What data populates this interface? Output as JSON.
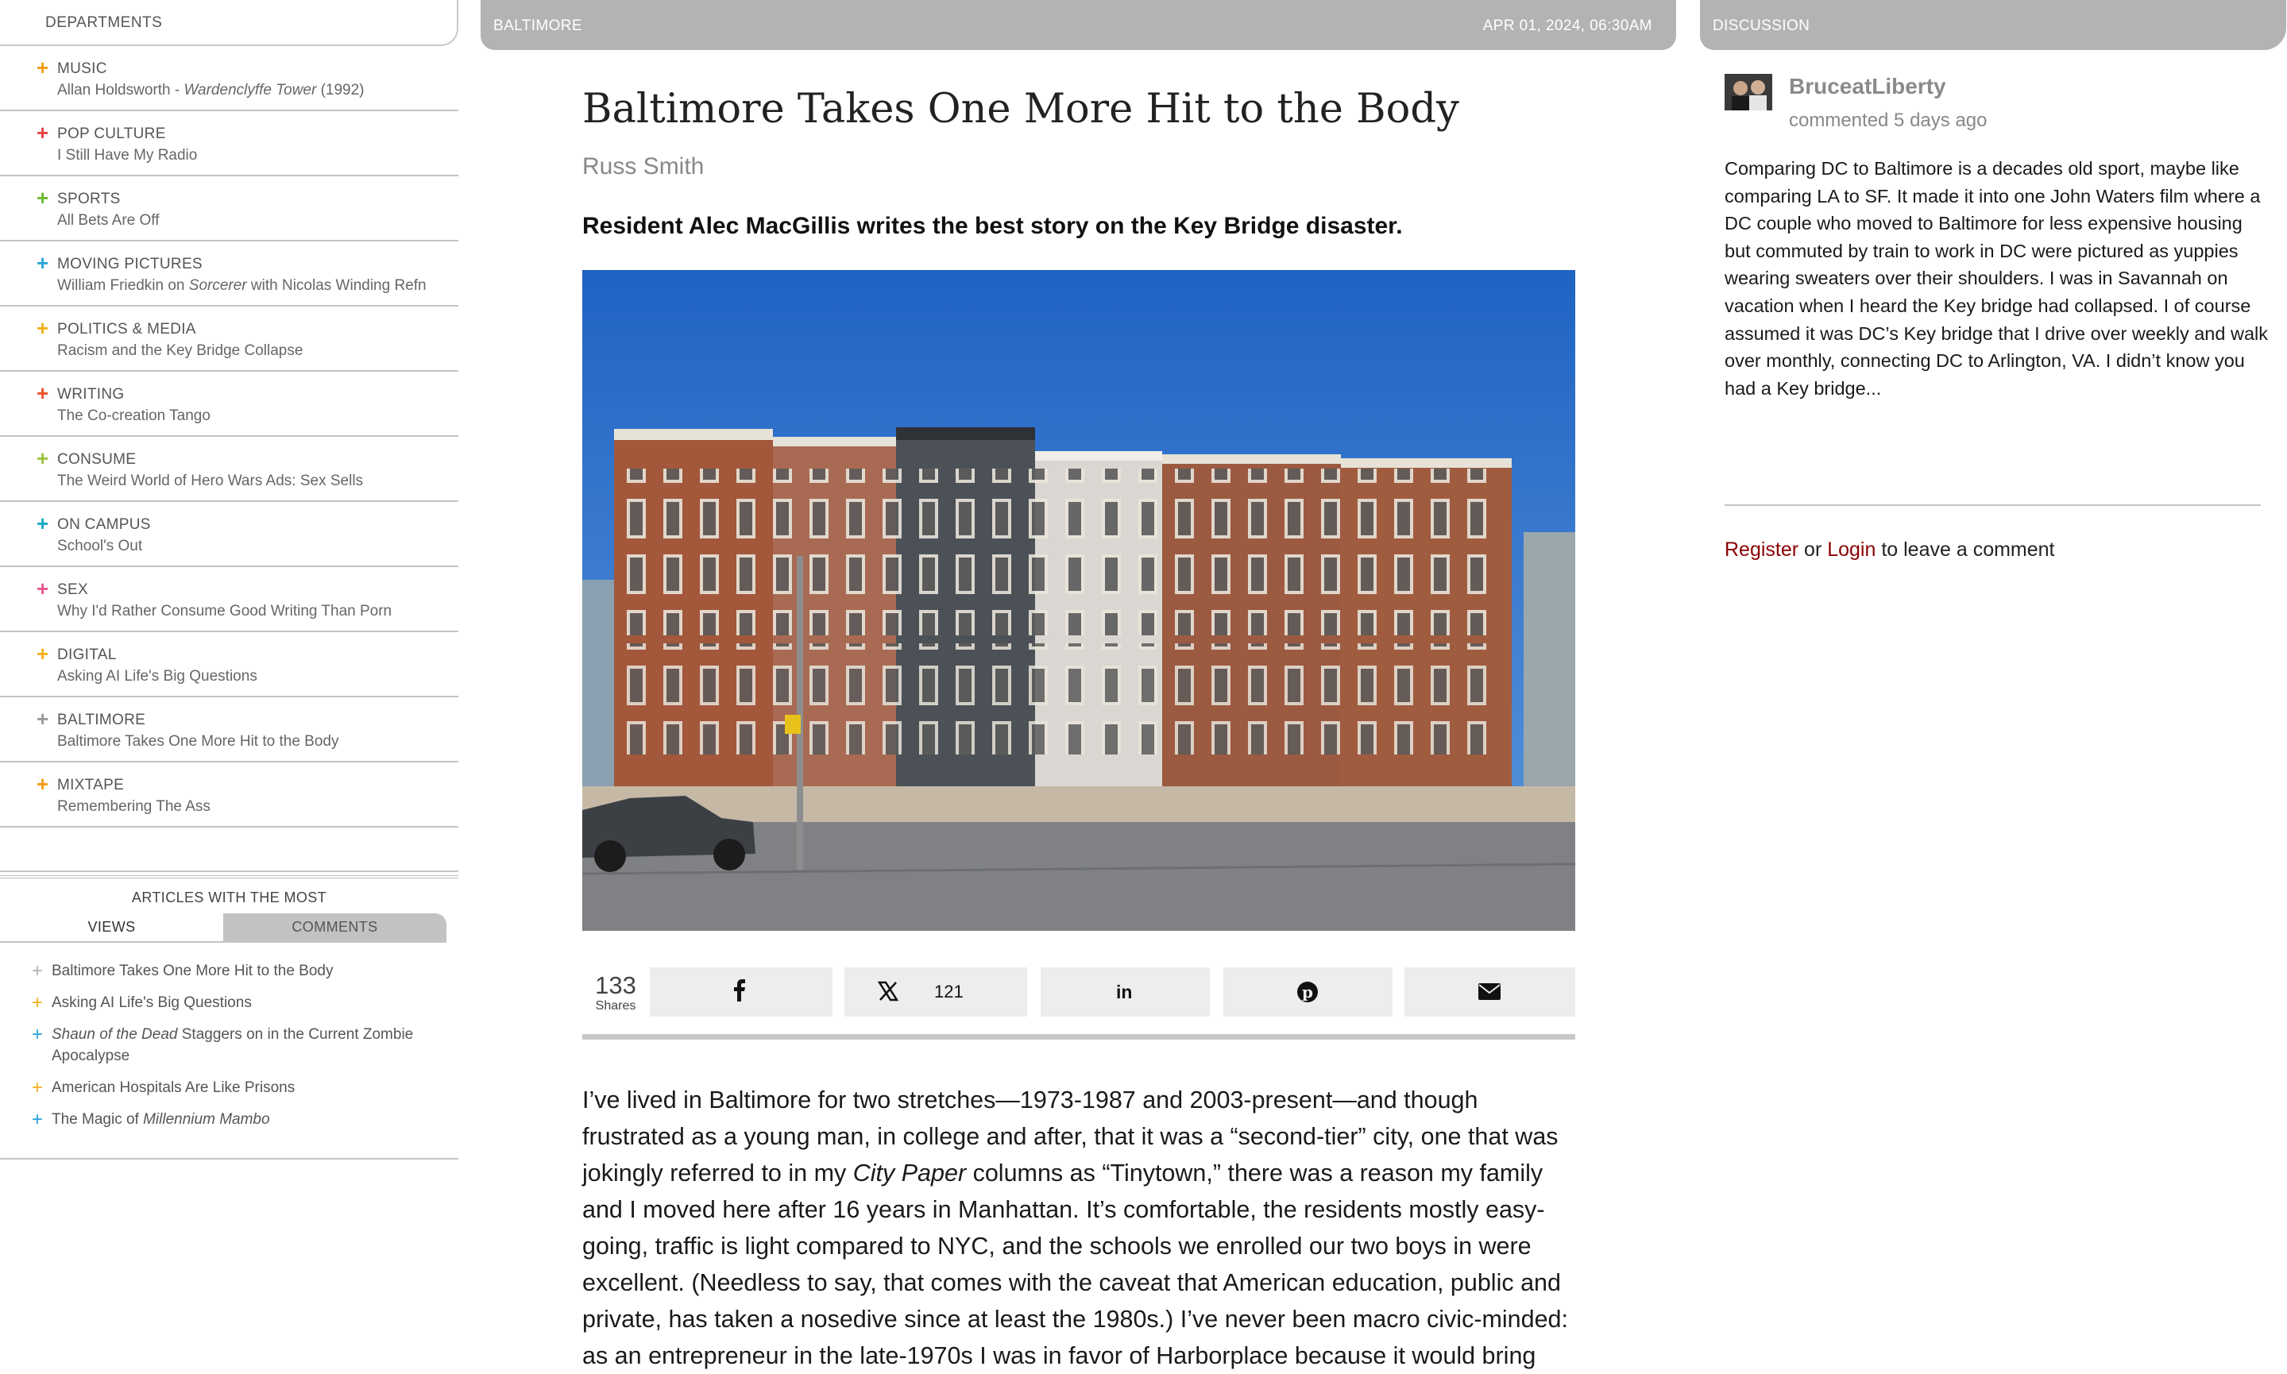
{
  "departments": {
    "header": "DEPARTMENTS",
    "items": [
      {
        "category": "MUSIC",
        "title_pre": "Allan Holdsworth - ",
        "title_italic": "Wardenclyffe Tower",
        "title_post": " (1992)",
        "color": "#f39c12"
      },
      {
        "category": "POP CULTURE",
        "title_pre": "I Still Have My Radio",
        "title_italic": "",
        "title_post": "",
        "color": "#e84343"
      },
      {
        "category": "SPORTS",
        "title_pre": "All Bets Are Off",
        "title_italic": "",
        "title_post": "",
        "color": "#6bb82e"
      },
      {
        "category": "MOVING PICTURES",
        "title_pre": "William Friedkin on ",
        "title_italic": "Sorcerer",
        "title_post": " with Nicolas Winding Refn",
        "color": "#2aa3d8"
      },
      {
        "category": "POLITICS & MEDIA",
        "title_pre": "Racism and the Key Bridge Collapse",
        "title_italic": "",
        "title_post": "",
        "color": "#f2b01e"
      },
      {
        "category": "WRITING",
        "title_pre": "The Co-creation Tango",
        "title_italic": "",
        "title_post": "",
        "color": "#e8532a"
      },
      {
        "category": "CONSUME",
        "title_pre": "The Weird World of Hero Wars Ads: Sex Sells",
        "title_italic": "",
        "title_post": "",
        "color": "#9ac43c"
      },
      {
        "category": "ON CAMPUS",
        "title_pre": "School's Out",
        "title_italic": "",
        "title_post": "",
        "color": "#17a9c4"
      },
      {
        "category": "SEX",
        "title_pre": "Why I'd Rather Consume Good Writing Than Porn",
        "title_italic": "",
        "title_post": "",
        "color": "#e8558c"
      },
      {
        "category": "DIGITAL",
        "title_pre": "Asking AI Life's Big Questions",
        "title_italic": "",
        "title_post": "",
        "color": "#f2b01e"
      },
      {
        "category": "BALTIMORE",
        "title_pre": "Baltimore Takes One More Hit to the Body",
        "title_italic": "",
        "title_post": "",
        "color": "#999999"
      },
      {
        "category": "MIXTAPE",
        "title_pre": "Remembering The Ass",
        "title_italic": "",
        "title_post": "",
        "color": "#f39c12"
      }
    ]
  },
  "most": {
    "header": "ARTICLES WITH THE MOST",
    "tab_views": "VIEWS",
    "tab_comments": "COMMENTS",
    "items": [
      {
        "pre": "Baltimore Takes One More Hit to the Body",
        "italic": "",
        "post": "",
        "color": "#b0b0b0"
      },
      {
        "pre": "Asking AI Life's Big Questions",
        "italic": "",
        "post": "",
        "color": "#f2b01e"
      },
      {
        "pre": "",
        "italic": "Shaun of the Dead",
        "post": " Staggers on in the Current Zombie Apocalypse",
        "color": "#2aa3d8"
      },
      {
        "pre": "American Hospitals Are Like Prisons",
        "italic": "",
        "post": "",
        "color": "#f2b01e"
      },
      {
        "pre": "The Magic of ",
        "italic": "Millennium Mambo",
        "post": "",
        "color": "#2aa3d8"
      }
    ]
  },
  "article": {
    "section": "BALTIMORE",
    "date": "APR 01, 2024, 06:30AM",
    "headline": "Baltimore Takes One More Hit to the Body",
    "author": "Russ Smith",
    "dek": "Resident Alec MacGillis writes the best story on the Key Bridge disaster.",
    "share_count": "133",
    "share_label": "Shares",
    "x_count": "121",
    "body_1": "I’ve lived in Baltimore for two stretches—1973-1987 and 2003-present—and though frustrated as a young man, in college and after, that it was a “second-tier” city, one that was jokingly referred to in my ",
    "body_italic": "City Paper",
    "body_2": " columns as “Tinytown,” there was a reason my family and I moved here after 16 years in Manhattan. It’s comfortable, the residents mostly easy-going, traffic is light compared to NYC, and the schools we enrolled our two boys in were excellent. (Needless to say, that comes with the caveat that American education, public and private, has taken a nosedive since at least the 1980s.) I’ve never been macro civic-minded: as an entrepreneur in the late-1970s I was in favor of Harborplace because it would bring"
  },
  "discussion": {
    "header": "DISCUSSION",
    "user": "BruceatLiberty",
    "time": "commented 5 days ago",
    "text": "Comparing DC to Baltimore is a decades old sport, maybe like comparing LA to SF. It made it into one John Waters film where a DC couple who moved to Baltimore for less expensive housing but commuted by train to work in DC were pictured as yuppies wearing sweaters over their shoulders. I was in Savannah on vacation when I heard the Key bridge had collapsed. I of course assumed it was DC’s Key bridge that I drive over weekly and walk over monthly, connecting DC to Arlington, VA. I didn’t know you had a Key bridge...",
    "register": "Register",
    "or": " or ",
    "login": "Login",
    "leave": " to leave a comment"
  }
}
